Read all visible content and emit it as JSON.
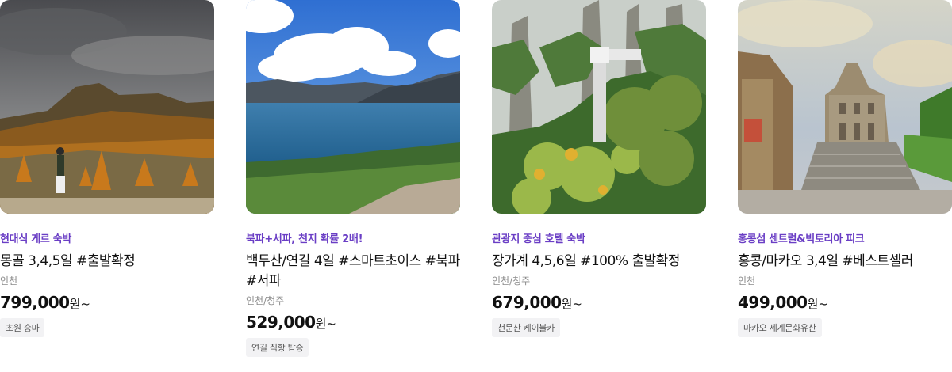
{
  "products": [
    {
      "promo": "현대식 게르 숙박",
      "title": "몽골 3,4,5일 #출발확정",
      "origin": "인천",
      "price": "799,000",
      "price_suffix": "원~",
      "badge": "초원 승마",
      "image_subject": "mongolia-steppe"
    },
    {
      "promo": "북파+서파, 천지 확률 2배!",
      "title": "백두산/연길 4일 #스마트초이스 #북파 #서파",
      "origin": "인천/청주",
      "price": "529,000",
      "price_suffix": "원~",
      "badge": "연길 직항 탑승",
      "image_subject": "baekdu-crater-lake"
    },
    {
      "promo": "관광지 중심 호텔 숙박",
      "title": "장가계 4,5,6일 #100% 출발확정",
      "origin": "인천/청주",
      "price": "679,000",
      "price_suffix": "원~",
      "badge": "천문산 케이블카",
      "image_subject": "zhangjiajie-cliffs"
    },
    {
      "promo": "홍콩섬 센트럴&빅토리아 피크",
      "title": "홍콩/마카오 3,4일 #베스트셀러",
      "origin": "인천",
      "price": "499,000",
      "price_suffix": "원~",
      "badge": "마카오 세계문화유산",
      "image_subject": "macau-st-pauls-ruins"
    }
  ],
  "colors": {
    "promo": "#6a3ec5",
    "badge_bg": "#f2f2f4",
    "muted": "#8b8b8b"
  }
}
